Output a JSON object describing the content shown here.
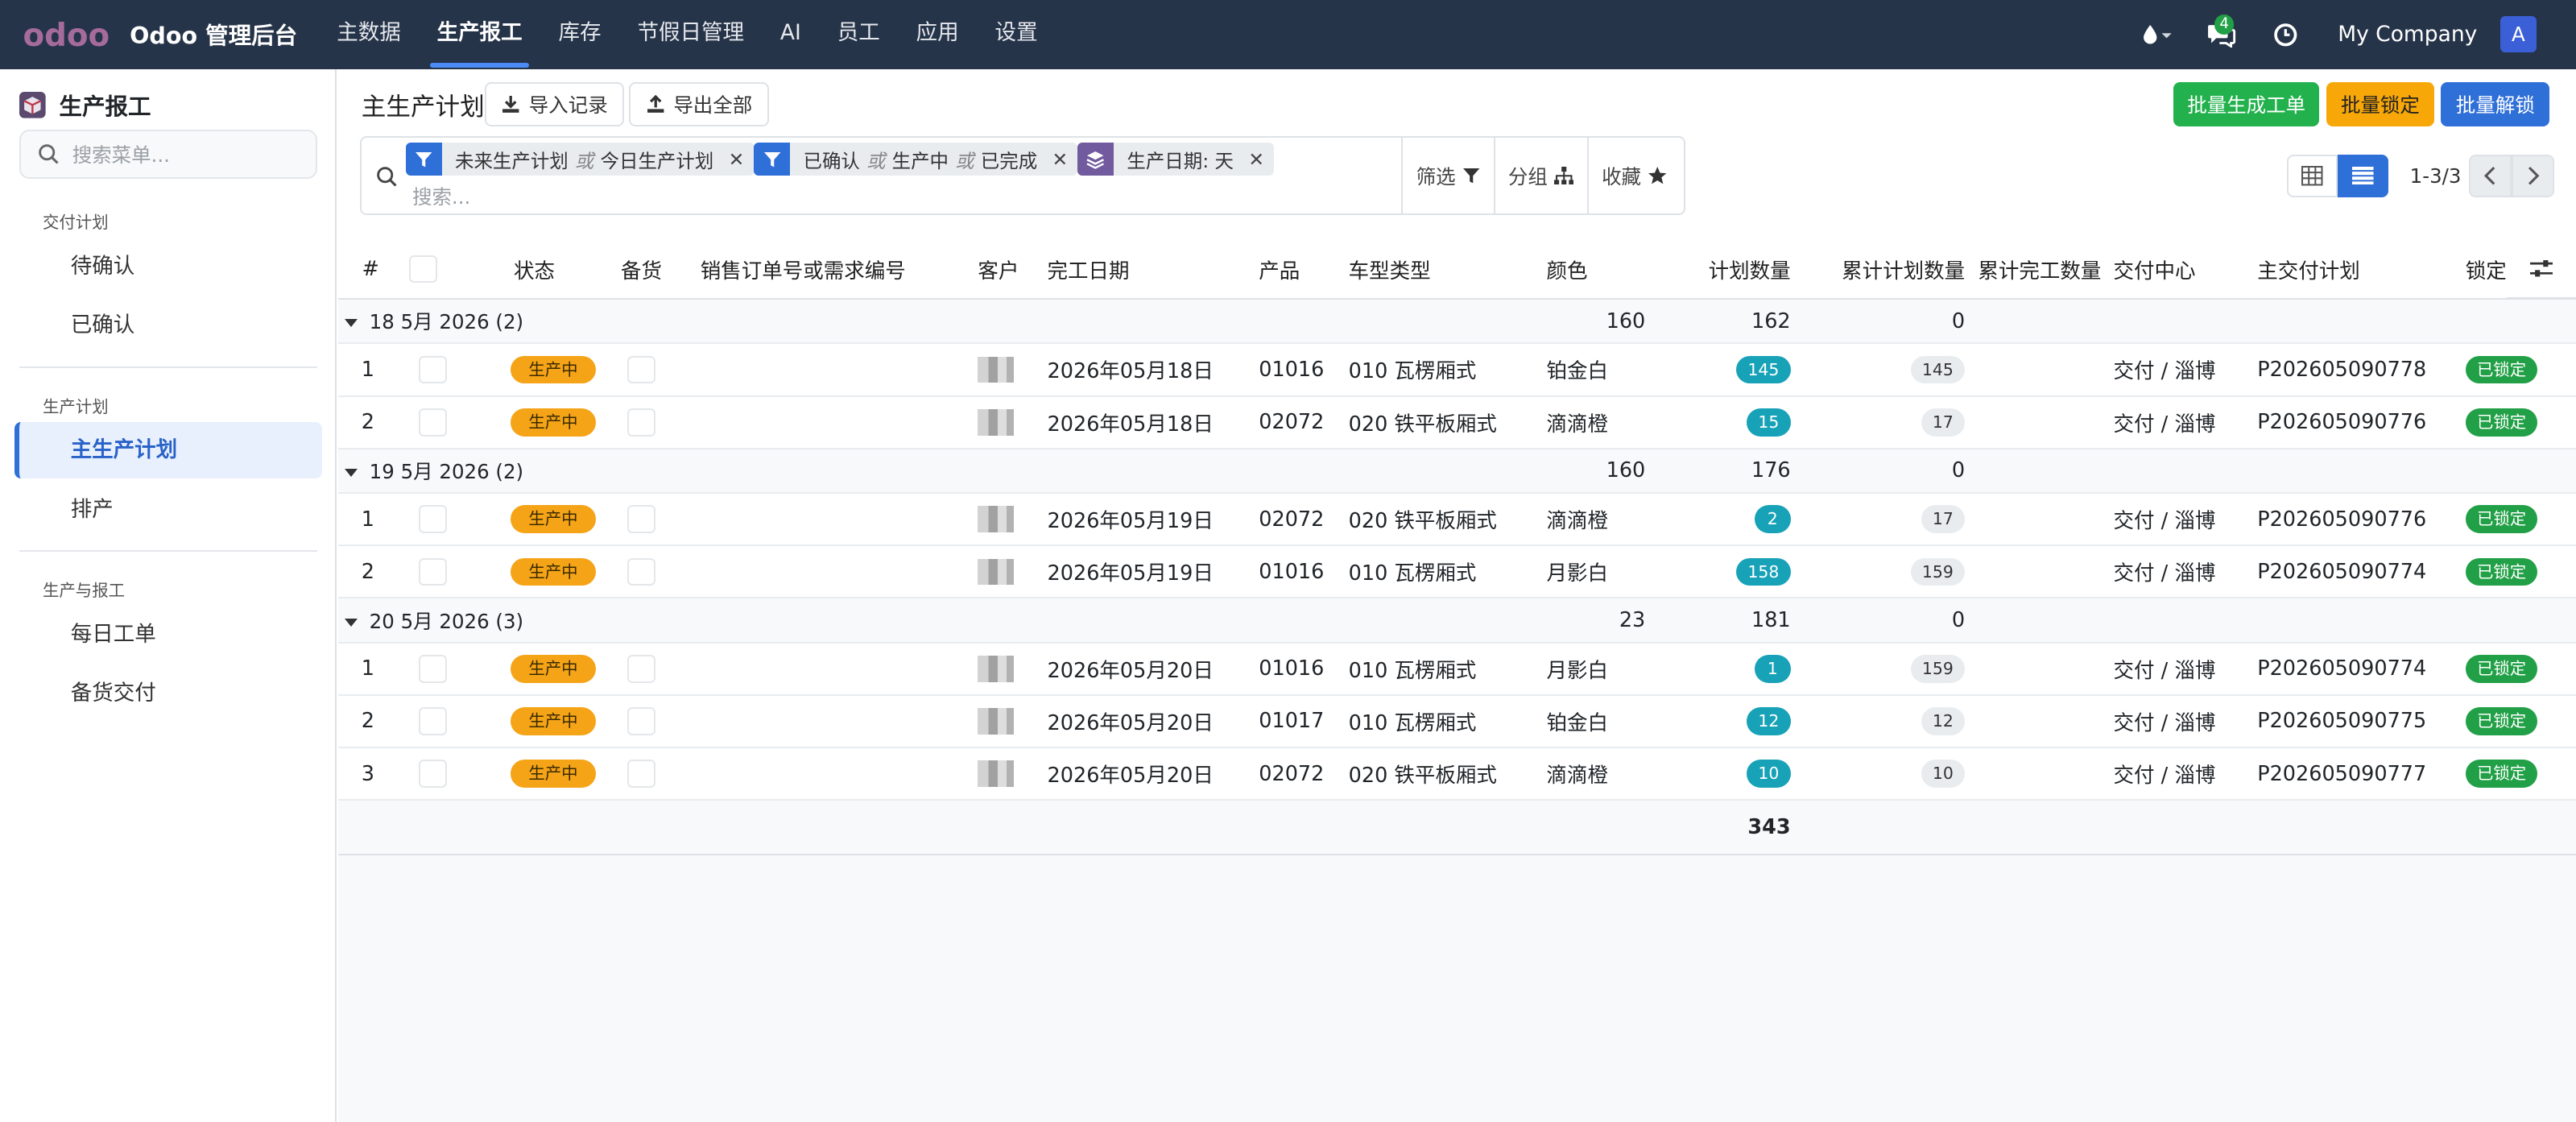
{
  "topbar": {
    "logo": "odoo",
    "title": "Odoo 管理后台",
    "nav": [
      "主数据",
      "生产报工",
      "库存",
      "节假日管理",
      "AI",
      "员工",
      "应用",
      "设置"
    ],
    "active_nav": 1,
    "notif_count": "4",
    "company": "My Company",
    "avatar": "A"
  },
  "sidebar": {
    "title": "生产报工",
    "search_placeholder": "搜索菜单...",
    "groups": [
      {
        "label": "交付计划",
        "items": [
          "待确认",
          "已确认"
        ]
      },
      {
        "label": "生产计划",
        "items": [
          "主生产计划",
          "排产"
        ]
      },
      {
        "label": "生产与报工",
        "items": [
          "每日工单",
          "备货交付"
        ]
      }
    ],
    "active_item": "主生产计划"
  },
  "control": {
    "title": "主生产计划",
    "import_btn": "导入记录",
    "export_btn": "导出全部",
    "btn_gen": "批量生成工单",
    "btn_lock": "批量锁定",
    "btn_unlock": "批量解锁",
    "colors": {
      "green": "#22b14c",
      "orange": "#f7a708",
      "blue": "#2f6fd8",
      "purple": "#715a9e"
    },
    "facets": [
      {
        "type": "filter",
        "values": [
          "未来生产计划",
          "今日生产计划"
        ]
      },
      {
        "type": "filter",
        "values": [
          "已确认",
          "生产中",
          "已完成"
        ]
      },
      {
        "type": "group",
        "values": [
          "生产日期: 天"
        ]
      }
    ],
    "or_word": "或",
    "search_placeholder": "搜索...",
    "filter_label": "筛选",
    "group_label": "分组",
    "fav_label": "收藏",
    "pager": "1-3/3"
  },
  "columns": [
    "#",
    "",
    "状态",
    "备货",
    "销售订单号或需求编号",
    "客户",
    "完工日期",
    "产品",
    "车型类型",
    "颜色",
    "计划数量",
    "累计计划数量",
    "累计完工数量",
    "交付中心",
    "主交付计划",
    "锁定状态"
  ],
  "groups": [
    {
      "label": "18 5月 2026 (2)",
      "sum_color": "160",
      "sum_plan": "162",
      "sum_cum": "0",
      "rows": [
        {
          "n": "1",
          "status": "生产中",
          "date": "2026年05月18日",
          "product": "01016",
          "model": "010 瓦楞厢式",
          "color": "铂金白",
          "plan": "145",
          "cum": "145",
          "center": "交付 / 淄博",
          "master": "P202605090778",
          "lock": "已锁定"
        },
        {
          "n": "2",
          "status": "生产中",
          "date": "2026年05月18日",
          "product": "02072",
          "model": "020 铁平板厢式",
          "color": "滴滴橙",
          "plan": "15",
          "cum": "17",
          "center": "交付 / 淄博",
          "master": "P202605090776",
          "lock": "已锁定"
        }
      ]
    },
    {
      "label": "19 5月 2026 (2)",
      "sum_color": "160",
      "sum_plan": "176",
      "sum_cum": "0",
      "rows": [
        {
          "n": "1",
          "status": "生产中",
          "date": "2026年05月19日",
          "product": "02072",
          "model": "020 铁平板厢式",
          "color": "滴滴橙",
          "plan": "2",
          "cum": "17",
          "center": "交付 / 淄博",
          "master": "P202605090776",
          "lock": "已锁定"
        },
        {
          "n": "2",
          "status": "生产中",
          "date": "2026年05月19日",
          "product": "01016",
          "model": "010 瓦楞厢式",
          "color": "月影白",
          "plan": "158",
          "cum": "159",
          "center": "交付 / 淄博",
          "master": "P202605090774",
          "lock": "已锁定"
        }
      ]
    },
    {
      "label": "20 5月 2026 (3)",
      "sum_color": "23",
      "sum_plan": "181",
      "sum_cum": "0",
      "rows": [
        {
          "n": "1",
          "status": "生产中",
          "date": "2026年05月20日",
          "product": "01016",
          "model": "010 瓦楞厢式",
          "color": "月影白",
          "plan": "1",
          "cum": "159",
          "center": "交付 / 淄博",
          "master": "P202605090774",
          "lock": "已锁定"
        },
        {
          "n": "2",
          "status": "生产中",
          "date": "2026年05月20日",
          "product": "01017",
          "model": "010 瓦楞厢式",
          "color": "铂金白",
          "plan": "12",
          "cum": "12",
          "center": "交付 / 淄博",
          "master": "P202605090775",
          "lock": "已锁定"
        },
        {
          "n": "3",
          "status": "生产中",
          "date": "2026年05月20日",
          "product": "02072",
          "model": "020 铁平板厢式",
          "color": "滴滴橙",
          "plan": "10",
          "cum": "10",
          "center": "交付 / 淄博",
          "master": "P202605090777",
          "lock": "已锁定"
        }
      ]
    }
  ],
  "total": "343"
}
